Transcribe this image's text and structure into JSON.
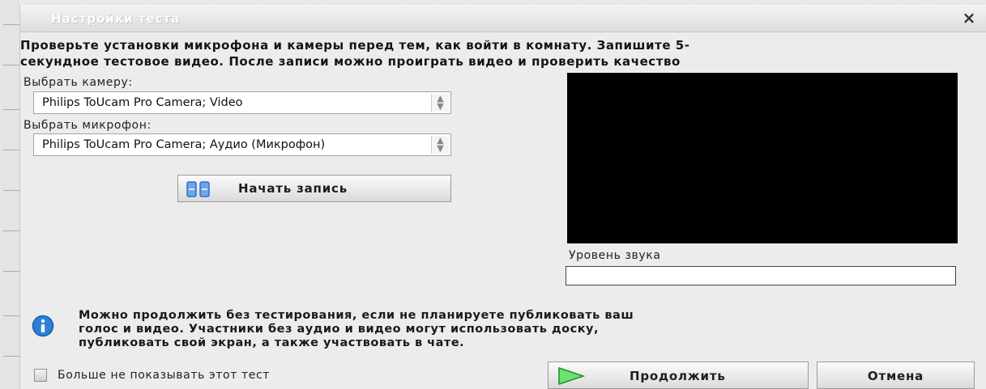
{
  "dialog": {
    "title": "Настройки теста",
    "close_label": "×",
    "instructions": [
      "Проверьте установки микрофона и камеры перед тем, как войти в комнату. Запишите 5-",
      "секундное тестовое видео. После записи можно проиграть видео и проверить качество"
    ]
  },
  "camera": {
    "label": "Выбрать камеру:",
    "selected": "Philips ToUcam Pro Camera; Video"
  },
  "microphone": {
    "label": "Выбрать микрофон:",
    "selected": "Philips ToUcam Pro Camera; Аудио (Микрофон)"
  },
  "record_button": {
    "label": "Начать запись",
    "icon": "pause-icon"
  },
  "sound": {
    "label": "Уровень звука",
    "level": 0
  },
  "info": {
    "icon": "info-icon",
    "lines": [
      "Можно продолжить без тестирования, если не планируете публиковать ваш",
      "голос и видео. Участники без аудио и видео могут использовать доску,",
      "публиковать свой экран, а также участвовать в чате."
    ]
  },
  "dont_show": {
    "label": "Больше не показывать этот тест",
    "checked": false
  },
  "continue_button": {
    "label": "Продолжить",
    "icon": "play-icon"
  },
  "cancel_button": {
    "label": "Отмена"
  },
  "colors": {
    "video_background": "#000000",
    "play_icon_green": "#35c23a",
    "record_icon_blue": "#2f6fd0",
    "info_icon_blue": "#2d7fd8"
  }
}
